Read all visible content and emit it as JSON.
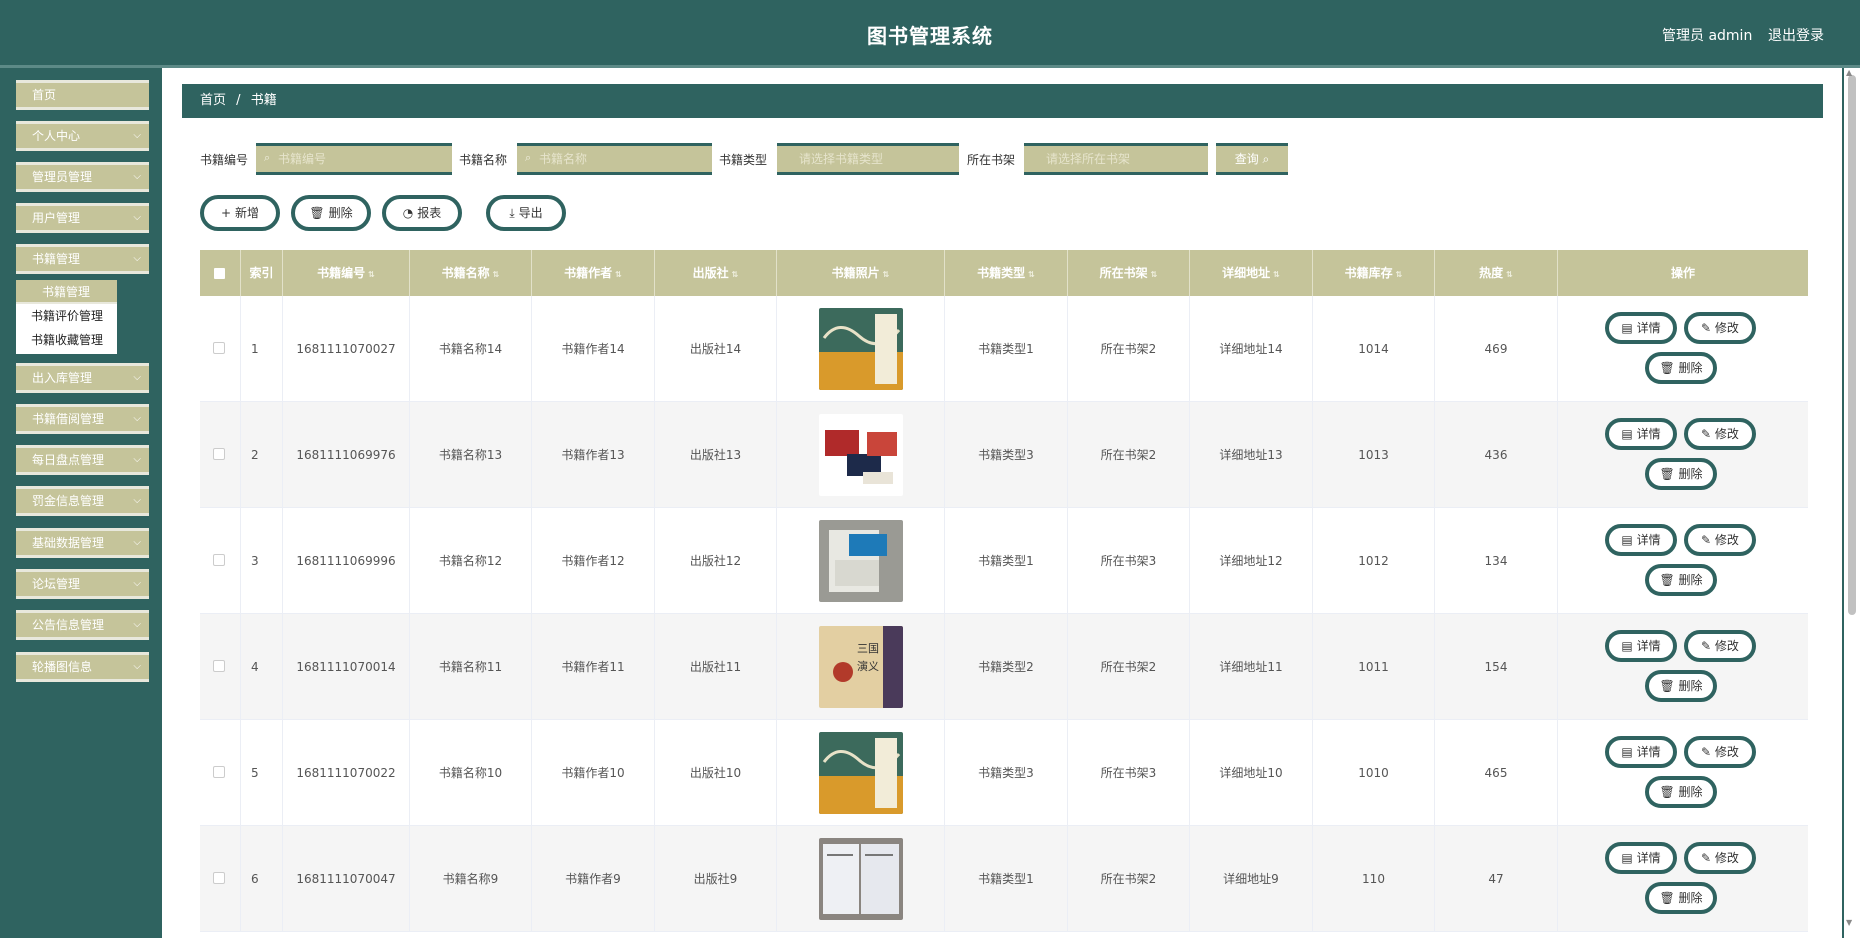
{
  "header": {
    "title": "图书管理系统",
    "admin": "管理员 admin",
    "logout": "退出登录"
  },
  "sidebar": {
    "items": [
      {
        "label": "首页"
      },
      {
        "label": "个人中心"
      },
      {
        "label": "管理员管理"
      },
      {
        "label": "用户管理"
      },
      {
        "label": "书籍管理"
      },
      {
        "label": "出入库管理"
      },
      {
        "label": "书籍借阅管理"
      },
      {
        "label": "每日盘点管理"
      },
      {
        "label": "罚金信息管理"
      },
      {
        "label": "基础数据管理"
      },
      {
        "label": "论坛管理"
      },
      {
        "label": "公告信息管理"
      },
      {
        "label": "轮播图信息"
      }
    ],
    "submenu": [
      {
        "label": "书籍管理"
      },
      {
        "label": "书籍评价管理"
      },
      {
        "label": "书籍收藏管理"
      }
    ]
  },
  "breadcrumb": {
    "home": "首页",
    "sep": "/",
    "current": "书籍"
  },
  "search": {
    "f1": {
      "label": "书籍编号",
      "placeholder": "书籍编号"
    },
    "f2": {
      "label": "书籍名称",
      "placeholder": "书籍名称"
    },
    "f3": {
      "label": "书籍类型",
      "placeholder": "请选择书籍类型"
    },
    "f4": {
      "label": "所在书架",
      "placeholder": "请选择所在书架"
    },
    "query": "查询"
  },
  "actions": {
    "add": "新增",
    "delete": "删除",
    "report": "报表",
    "export": "导出"
  },
  "table": {
    "headers": [
      "索引",
      "书籍编号",
      "书籍名称",
      "书籍作者",
      "出版社",
      "书籍照片",
      "书籍类型",
      "所在书架",
      "详细地址",
      "书籍库存",
      "热度",
      "操作"
    ],
    "rows": [
      {
        "index": "1",
        "code": "1681111070027",
        "name": "书籍名称14",
        "author": "书籍作者14",
        "press": "出版社14",
        "type": "书籍类型1",
        "shelf": "所在书架2",
        "address": "详细地址14",
        "stock": "1014",
        "heat": "469"
      },
      {
        "index": "2",
        "code": "1681111069976",
        "name": "书籍名称13",
        "author": "书籍作者13",
        "press": "出版社13",
        "type": "书籍类型3",
        "shelf": "所在书架2",
        "address": "详细地址13",
        "stock": "1013",
        "heat": "436"
      },
      {
        "index": "3",
        "code": "1681111069996",
        "name": "书籍名称12",
        "author": "书籍作者12",
        "press": "出版社12",
        "type": "书籍类型1",
        "shelf": "所在书架3",
        "address": "详细地址12",
        "stock": "1012",
        "heat": "134"
      },
      {
        "index": "4",
        "code": "1681111070014",
        "name": "书籍名称11",
        "author": "书籍作者11",
        "press": "出版社11",
        "type": "书籍类型2",
        "shelf": "所在书架2",
        "address": "详细地址11",
        "stock": "1011",
        "heat": "154"
      },
      {
        "index": "5",
        "code": "1681111070022",
        "name": "书籍名称10",
        "author": "书籍作者10",
        "press": "出版社10",
        "type": "书籍类型3",
        "shelf": "所在书架3",
        "address": "详细地址10",
        "stock": "1010",
        "heat": "465"
      },
      {
        "index": "6",
        "code": "1681111070047",
        "name": "书籍名称9",
        "author": "书籍作者9",
        "press": "出版社9",
        "type": "书籍类型1",
        "shelf": "所在书架2",
        "address": "详细地址9",
        "stock": "110",
        "heat": "47"
      }
    ],
    "op": {
      "detail": "详情",
      "edit": "修改",
      "delete": "删除"
    }
  }
}
